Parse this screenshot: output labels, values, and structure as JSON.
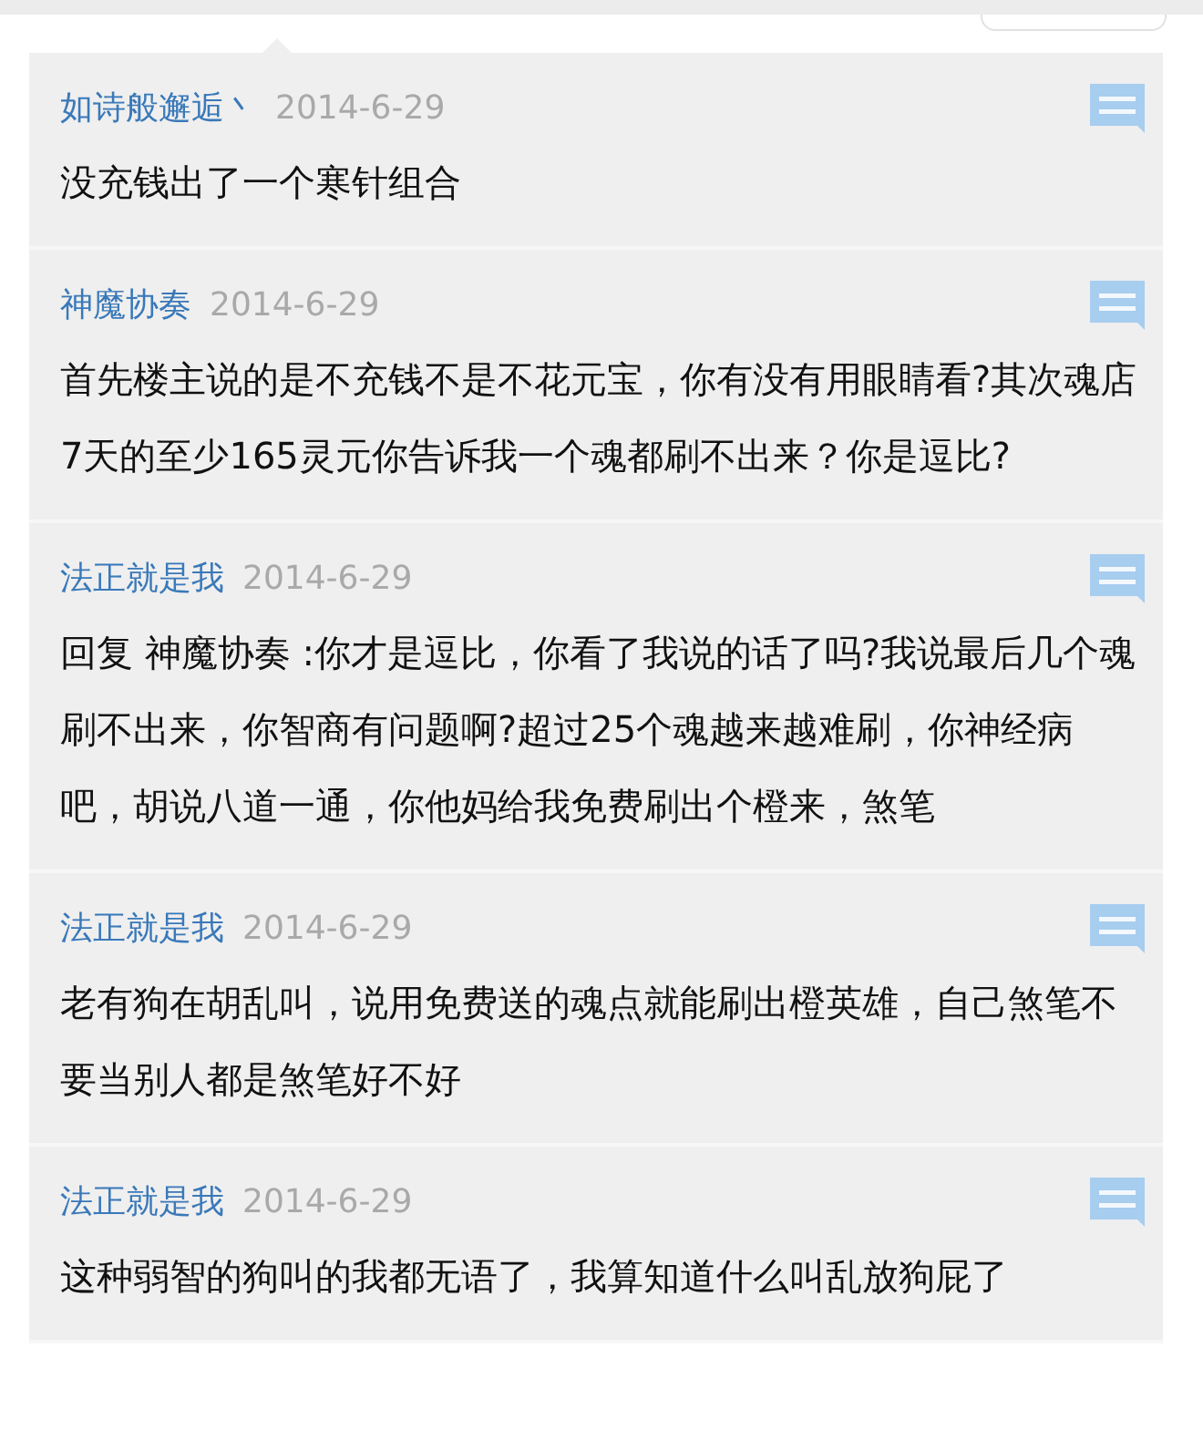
{
  "comments": [
    {
      "author": "如诗般邂逅丶",
      "date": "2014-6-29",
      "text": "没充钱出了一个寒针组合"
    },
    {
      "author": "神魔协奏",
      "date": "2014-6-29",
      "text": "首先楼主说的是不充钱不是不花元宝，你有没有用眼睛看?其次魂店7天的至少165灵元你告诉我一个魂都刷不出来？你是逗比?"
    },
    {
      "author": "法正就是我",
      "date": "2014-6-29",
      "text": "回复 神魔协奏 :你才是逗比，你看了我说的话了吗?我说最后几个魂刷不出来，你智商有问题啊?超过25个魂越来越难刷，你神经病吧，胡说八道一通，你他妈给我免费刷出个橙来，煞笔"
    },
    {
      "author": "法正就是我",
      "date": "2014-6-29",
      "text": "老有狗在胡乱叫，说用免费送的魂点就能刷出橙英雄，自己煞笔不要当别人都是煞笔好不好"
    },
    {
      "author": "法正就是我",
      "date": "2014-6-29",
      "text": "这种弱智的狗叫的我都无语了，我算知道什么叫乱放狗屁了"
    }
  ]
}
